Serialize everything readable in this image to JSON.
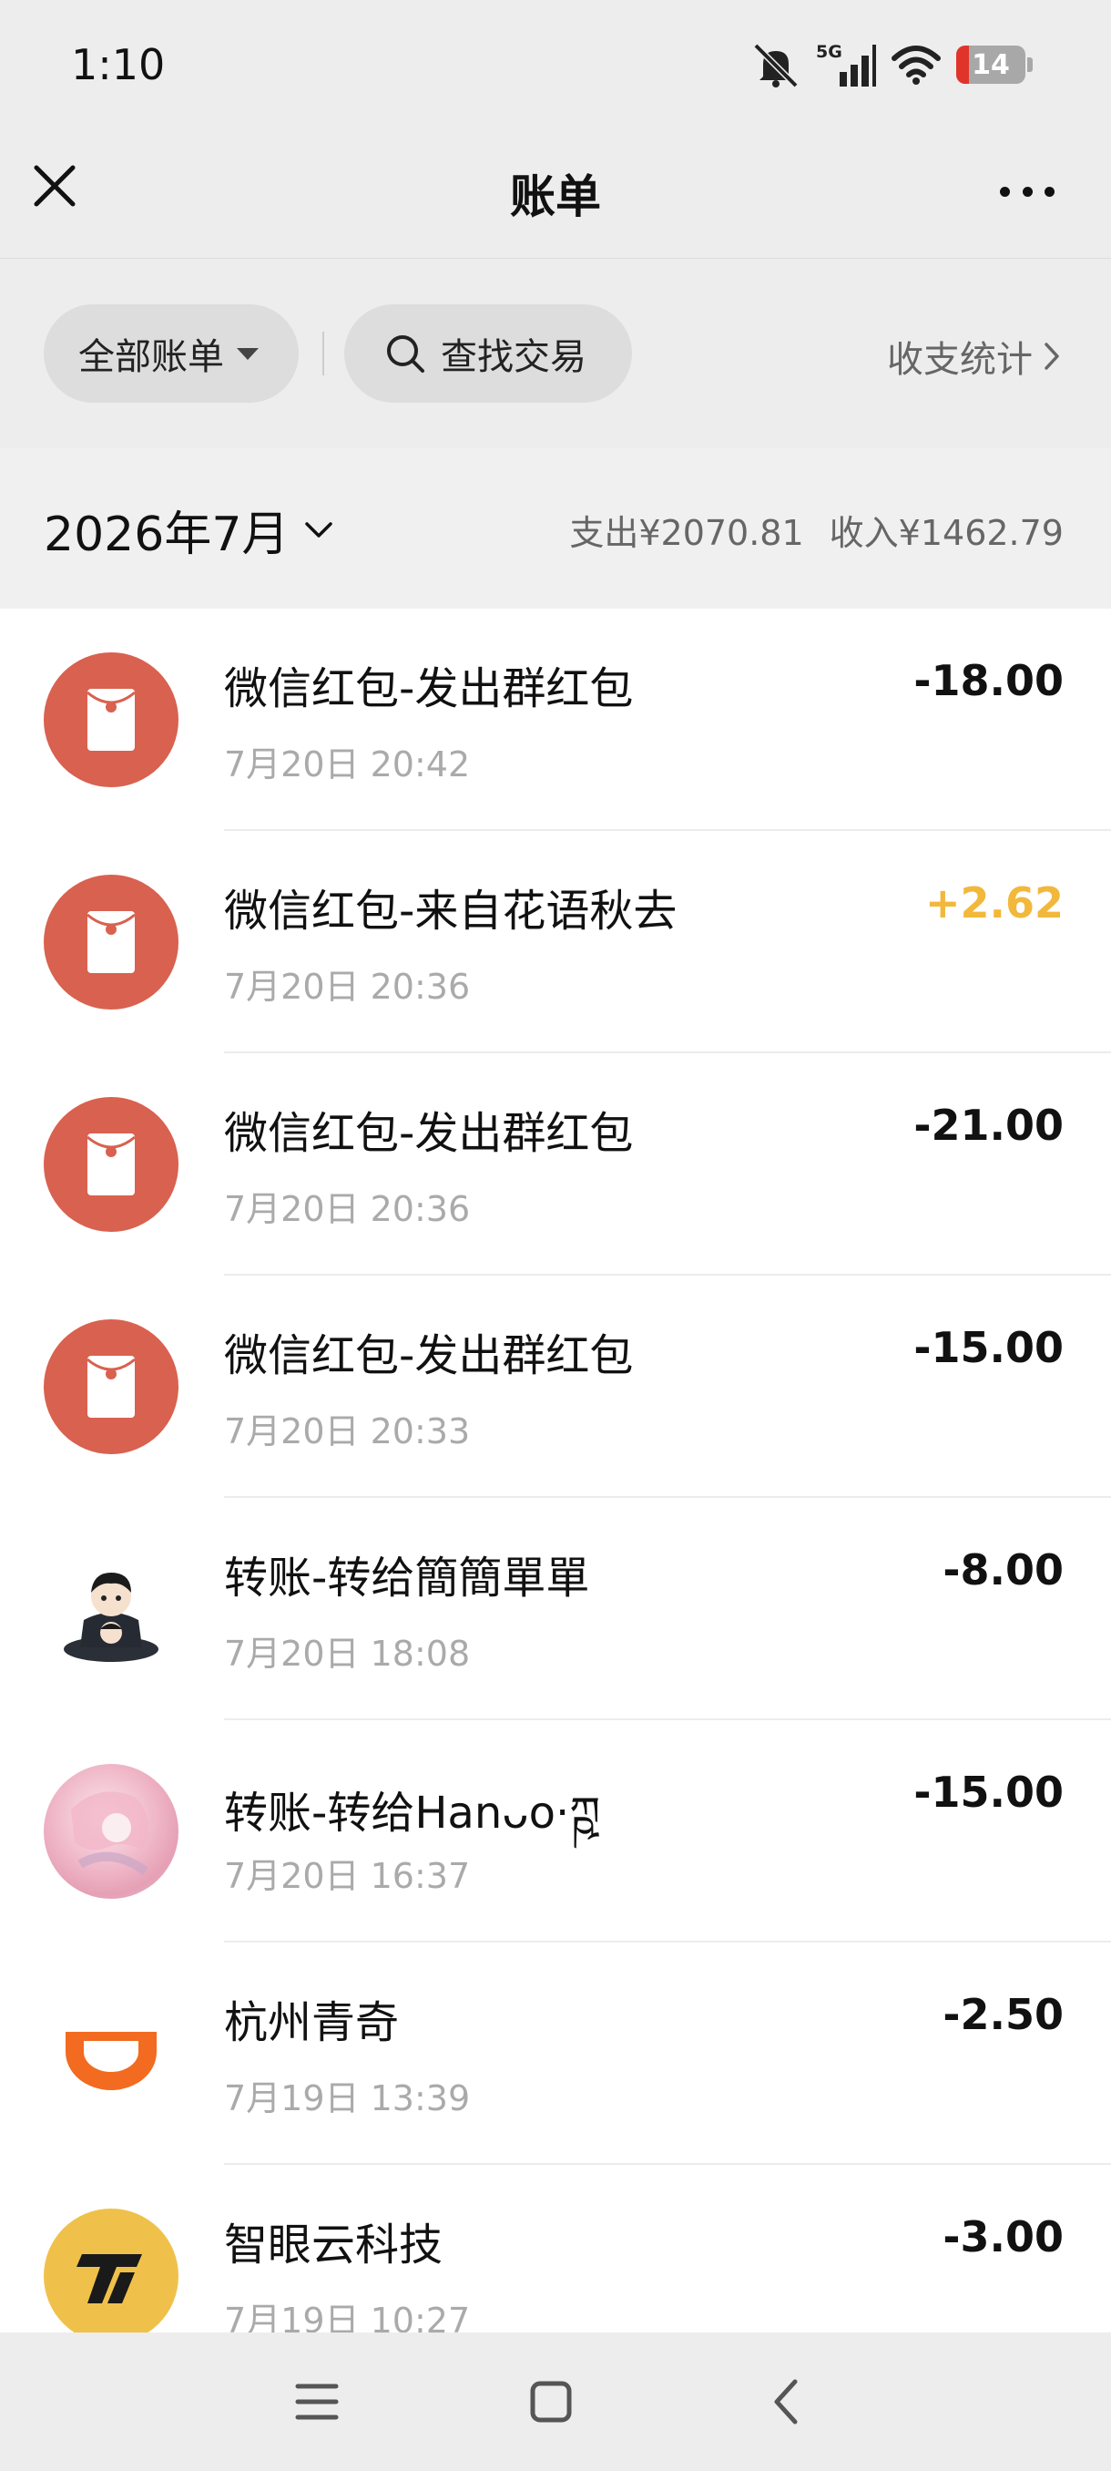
{
  "status_bar": {
    "time": "1:10",
    "network": "5G",
    "battery": "14"
  },
  "header": {
    "title": "账单"
  },
  "filters": {
    "all_label": "全部账单",
    "search_label": "查找交易",
    "stats_label": "收支统计"
  },
  "month": {
    "label": "2026年7月",
    "expense": "支出¥2070.81",
    "income": "收入¥1462.79"
  },
  "transactions": [
    {
      "title": "微信红包-发出群红包",
      "time": "7月20日 20:42",
      "amount": "-18.00",
      "type": "expense",
      "icon": "red-packet-icon"
    },
    {
      "title": "微信红包-来自花语秋去",
      "time": "7月20日 20:36",
      "amount": "+2.62",
      "type": "income",
      "icon": "red-packet-icon"
    },
    {
      "title": "微信红包-发出群红包",
      "time": "7月20日 20:36",
      "amount": "-21.00",
      "type": "expense",
      "icon": "red-packet-icon"
    },
    {
      "title": "微信红包-发出群红包",
      "time": "7月20日 20:33",
      "amount": "-15.00",
      "type": "expense",
      "icon": "red-packet-icon"
    },
    {
      "title": "转账-转给簡簡單單",
      "time": "7月20日 18:08",
      "amount": "-8.00",
      "type": "expense",
      "icon": "cartoon-avatar"
    },
    {
      "title": "转账-转给Hanᴗo·ཀྵ",
      "time": "7月20日 16:37",
      "amount": "-15.00",
      "type": "expense",
      "icon": "anime-avatar"
    },
    {
      "title": "杭州青奇",
      "time": "7月19日 13:39",
      "amount": "-2.50",
      "type": "expense",
      "icon": "didi-logo"
    },
    {
      "title": "智眼云科技",
      "time": "7月19日 10:27",
      "amount": "-3.00",
      "type": "expense",
      "icon": "zhiyan-logo"
    }
  ],
  "colors": {
    "red_packet": "#d9614f",
    "income": "#f2b83c",
    "background": "#ededed"
  }
}
